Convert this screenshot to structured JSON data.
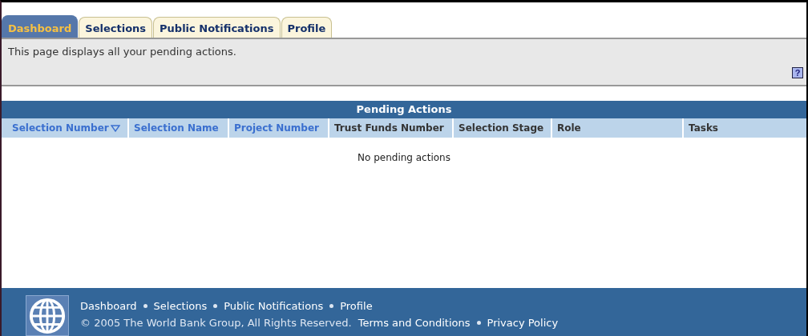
{
  "tabs": [
    {
      "label": "Dashboard",
      "selected": true
    },
    {
      "label": "Selections",
      "selected": false
    },
    {
      "label": "Public Notifications",
      "selected": false
    },
    {
      "label": "Profile",
      "selected": false
    }
  ],
  "description": "This page displays all your pending actions.",
  "help": {
    "label": "?"
  },
  "table": {
    "title": "Pending Actions",
    "columns": [
      {
        "label": "Selection Number",
        "sortable": true,
        "sorted": true
      },
      {
        "label": "Selection Name",
        "sortable": true,
        "sorted": false
      },
      {
        "label": "Project Number",
        "sortable": true,
        "sorted": false
      },
      {
        "label": "Trust Funds Number",
        "sortable": false,
        "sorted": false
      },
      {
        "label": "Selection Stage",
        "sortable": false,
        "sorted": false
      },
      {
        "label": "Role",
        "sortable": false,
        "sorted": false
      },
      {
        "label": "Tasks",
        "sortable": false,
        "sorted": false
      }
    ],
    "empty_message": "No pending actions"
  },
  "footer": {
    "links": [
      "Dashboard",
      "Selections",
      "Public Notifications",
      "Profile"
    ],
    "copyright": "© 2005 The World Bank Group, All Rights Reserved.",
    "legal_links": [
      "Terms and Conditions",
      "Privacy Policy"
    ]
  }
}
